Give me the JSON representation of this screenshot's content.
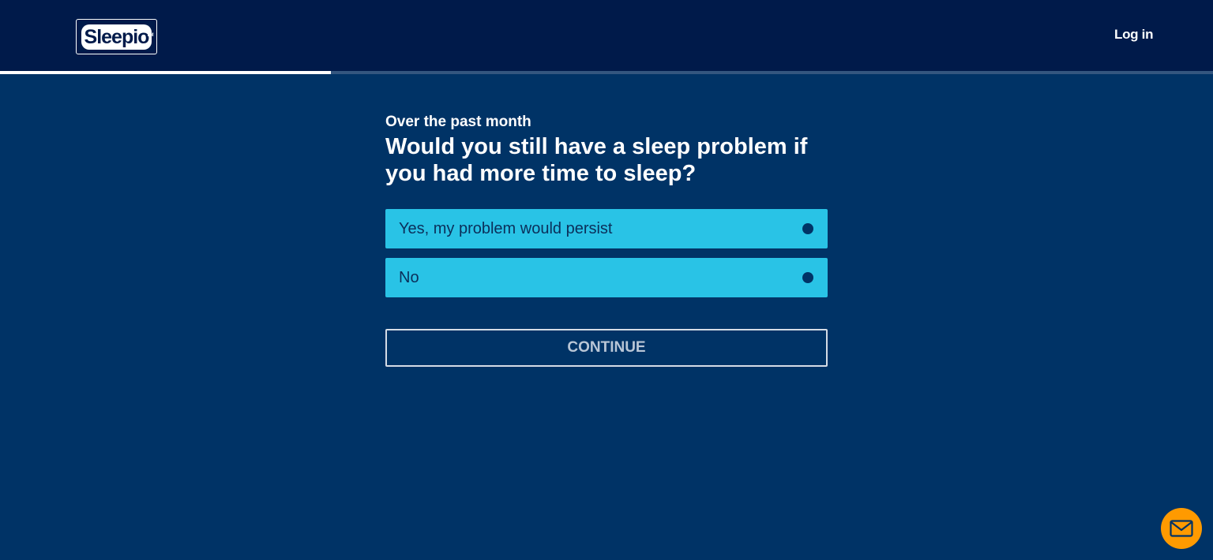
{
  "header": {
    "logo_text": "Sleepio",
    "logo_tm": "TM",
    "login_label": "Log in"
  },
  "progress": {
    "fraction": 0.273
  },
  "question": {
    "subtitle": "Over the past month",
    "text": "Would you still have a sleep problem if you had more time to sleep?"
  },
  "options": [
    {
      "label": "Yes, my problem would persist"
    },
    {
      "label": "No"
    }
  ],
  "continue_label": "CONTINUE",
  "chat": {
    "icon": "mail-icon",
    "color": "#ff9a00"
  },
  "colors": {
    "header_bg": "#001a4a",
    "page_bg": "#003366",
    "option_bg": "#29c3e6"
  }
}
